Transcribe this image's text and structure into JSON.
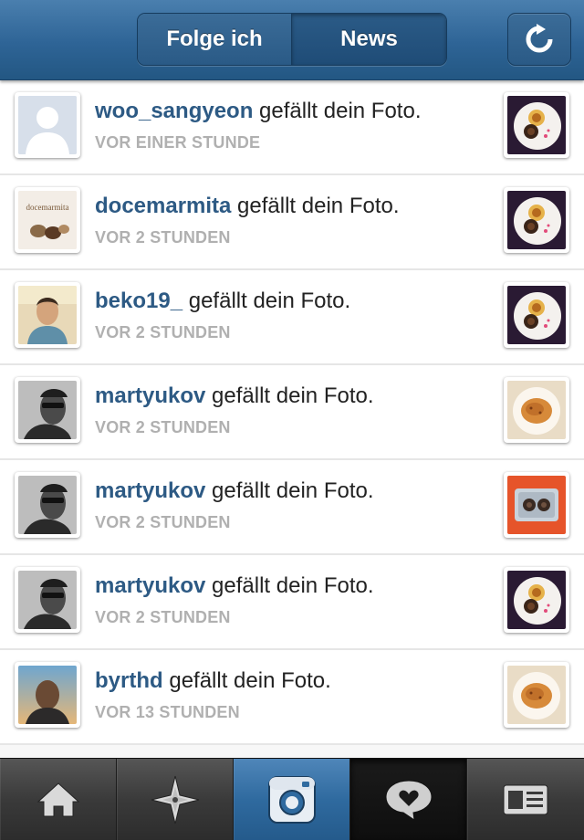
{
  "header": {
    "tabs": [
      {
        "label": "Folge ich",
        "active": false
      },
      {
        "label": "News",
        "active": true
      }
    ],
    "refresh_icon": "refresh-icon"
  },
  "feed": [
    {
      "username": "woo_sangyeon",
      "action": " gefällt dein Foto.",
      "time": "VOR EINER STUNDE"
    },
    {
      "username": "docemarmita",
      "action": " gefällt dein Foto.",
      "time": "VOR 2 STUNDEN",
      "avatar_text": "docemarmita"
    },
    {
      "username": "beko19_",
      "action": " gefällt dein Foto.",
      "time": "VOR 2 STUNDEN"
    },
    {
      "username": "martyukov",
      "action": " gefällt dein Foto.",
      "time": "VOR 2 STUNDEN"
    },
    {
      "username": "martyukov",
      "action": " gefällt dein Foto.",
      "time": "VOR 2 STUNDEN"
    },
    {
      "username": "martyukov",
      "action": " gefällt dein Foto.",
      "time": "VOR 2 STUNDEN"
    },
    {
      "username": "byrthd",
      "action": " gefällt dein Foto.",
      "time": "VOR 13 STUNDEN"
    }
  ],
  "tabbar": [
    {
      "icon": "home-icon"
    },
    {
      "icon": "explore-icon"
    },
    {
      "icon": "camera-icon"
    },
    {
      "icon": "news-heart-bubble-icon"
    },
    {
      "icon": "profile-icon"
    }
  ],
  "colors": {
    "accent": "#2d5a84",
    "header": "#2e6496",
    "time": "#b0b0b0"
  }
}
